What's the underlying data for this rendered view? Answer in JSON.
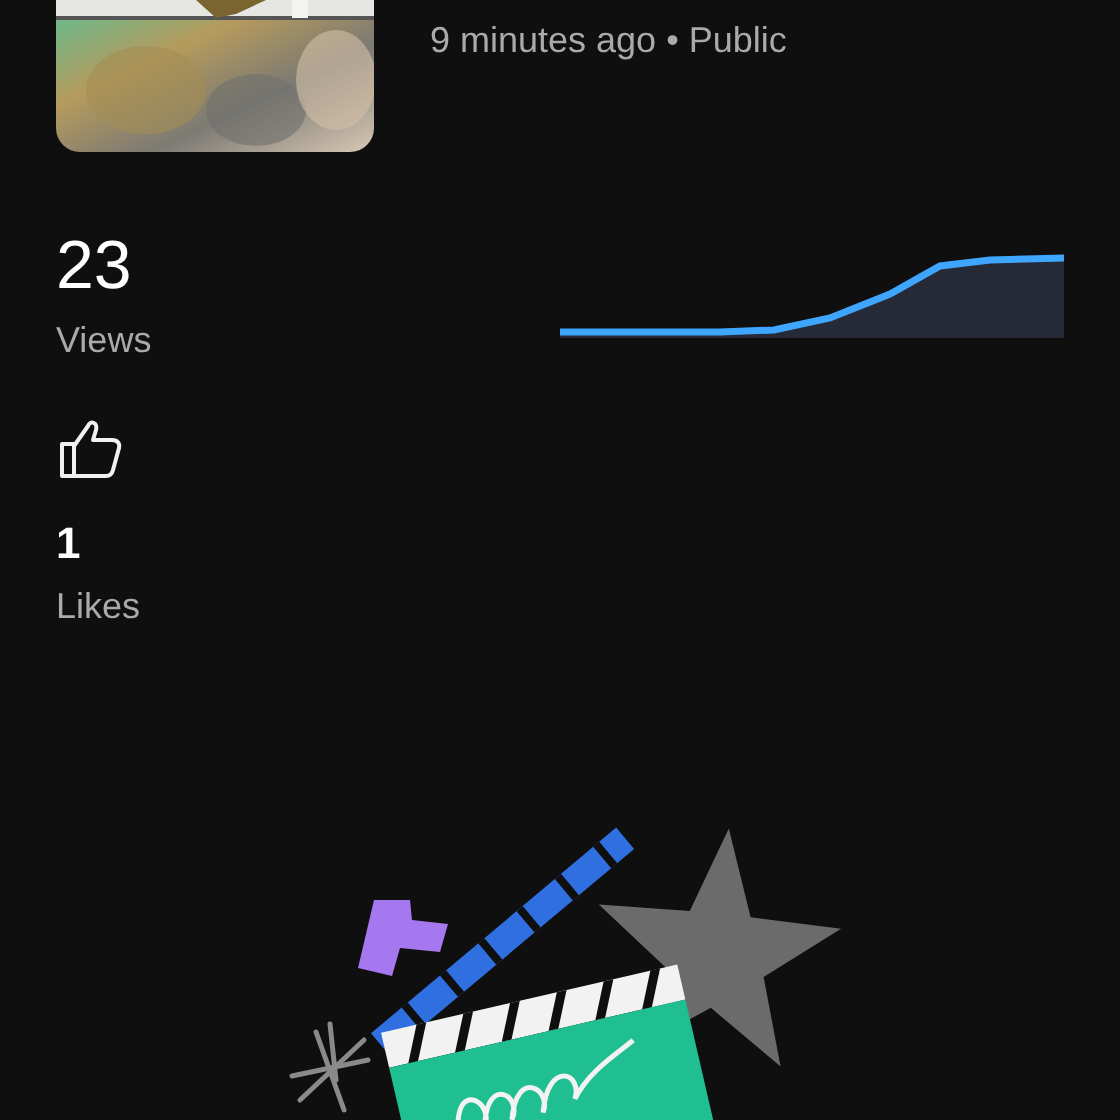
{
  "video": {
    "meta": "9 minutes ago • Public"
  },
  "stats": [
    {
      "kind": "views",
      "value": "23",
      "label": "Views"
    },
    {
      "kind": "likes",
      "value": "1",
      "label": "Likes"
    }
  ],
  "illustration": {
    "kind": "clapperboard"
  }
}
